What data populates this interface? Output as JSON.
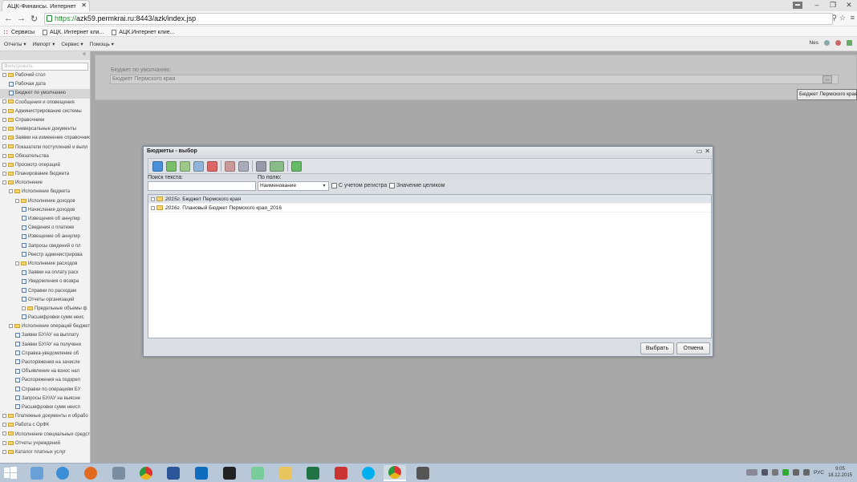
{
  "browser": {
    "tab_title": "АЦК-Финансы. Интернет",
    "url_scheme": "https://",
    "url_rest": "azk59.permkrai.ru:8443/azk/index.jsp",
    "bookmarks": [
      "Сервисы",
      "АЦК. Интернет кли...",
      "АЦК.Интернет клие..."
    ]
  },
  "menubar": {
    "items": [
      "Отчеты ▾",
      "Импорт ▾",
      "Сервис ▾",
      "Помощь ▾"
    ],
    "user": "Nes"
  },
  "sidebar": {
    "filter_placeholder": "Фильтровать",
    "collapse": "«",
    "items": [
      {
        "label": "Рабочий стол",
        "level": 0,
        "type": "folder"
      },
      {
        "label": "Рабочая дата",
        "level": 1,
        "type": "doc"
      },
      {
        "label": "Бюджет по умолчанию",
        "level": 1,
        "type": "doc",
        "selected": true
      },
      {
        "label": "Сообщения и оповещения",
        "level": 0,
        "type": "folder"
      },
      {
        "label": "Администрирование системы",
        "level": 0,
        "type": "folder"
      },
      {
        "label": "Справочники",
        "level": 0,
        "type": "folder"
      },
      {
        "label": "Универсальные документы",
        "level": 0,
        "type": "folder"
      },
      {
        "label": "Заявки на изменение справочник",
        "level": 0,
        "type": "folder"
      },
      {
        "label": "Показатели поступлений и выпл",
        "level": 0,
        "type": "folder"
      },
      {
        "label": "Обязательства",
        "level": 0,
        "type": "folder"
      },
      {
        "label": "Просмотр операций",
        "level": 0,
        "type": "folder"
      },
      {
        "label": "Планирование бюджета",
        "level": 0,
        "type": "folder"
      },
      {
        "label": "Исполнение",
        "level": 0,
        "type": "folder"
      },
      {
        "label": "Исполнение бюджета",
        "level": 1,
        "type": "folder"
      },
      {
        "label": "Исполнение доходов",
        "level": 2,
        "type": "folder"
      },
      {
        "label": "Начисления доходов",
        "level": 3,
        "type": "doc"
      },
      {
        "label": "Извещения об аннулир",
        "level": 3,
        "type": "doc"
      },
      {
        "label": "Сведения о платеже",
        "level": 3,
        "type": "doc"
      },
      {
        "label": "Извещение об аннулир",
        "level": 3,
        "type": "doc"
      },
      {
        "label": "Запросы сведений о пл",
        "level": 3,
        "type": "doc"
      },
      {
        "label": "Реестр администрирова",
        "level": 3,
        "type": "doc"
      },
      {
        "label": "Исполнение расходов",
        "level": 2,
        "type": "folder"
      },
      {
        "label": "Заявки на оплату расх",
        "level": 3,
        "type": "doc"
      },
      {
        "label": "Уведомления о возвра",
        "level": 3,
        "type": "doc"
      },
      {
        "label": "Справки по расходам",
        "level": 3,
        "type": "doc"
      },
      {
        "label": "Отчеты организаций",
        "level": 3,
        "type": "doc"
      },
      {
        "label": "Предельные объемы ф",
        "level": 3,
        "type": "folder"
      },
      {
        "label": "Расшифровки сумм неис",
        "level": 3,
        "type": "doc"
      },
      {
        "label": "Исполнение операций бюджет",
        "level": 1,
        "type": "folder"
      },
      {
        "label": "Заявки БУ/АУ на выплату",
        "level": 2,
        "type": "doc"
      },
      {
        "label": "Заявки БУ/АУ на получени",
        "level": 2,
        "type": "doc"
      },
      {
        "label": "Справка-уведомление об",
        "level": 2,
        "type": "doc"
      },
      {
        "label": "Распоряжения на зачисле",
        "level": 2,
        "type": "doc"
      },
      {
        "label": "Объявление на взнос нал",
        "level": 2,
        "type": "doc"
      },
      {
        "label": "Распоряжения на подкреп",
        "level": 2,
        "type": "doc"
      },
      {
        "label": "Справки по операциям БУ",
        "level": 2,
        "type": "doc"
      },
      {
        "label": "Запросы БУ/АУ на выясне",
        "level": 2,
        "type": "doc"
      },
      {
        "label": "Расшифровки сумм неисп",
        "level": 2,
        "type": "doc"
      },
      {
        "label": "Платежные документы и обрабо",
        "level": 0,
        "type": "folder"
      },
      {
        "label": "Работа с ОрФК",
        "level": 0,
        "type": "folder"
      },
      {
        "label": "Исполнение специальных средст",
        "level": 0,
        "type": "folder"
      },
      {
        "label": "Отчеты учреждений",
        "level": 0,
        "type": "folder"
      },
      {
        "label": "Каталог платных услуг",
        "level": 0,
        "type": "folder"
      }
    ]
  },
  "budget_panel": {
    "label": "Бюджет по умолчанию:",
    "value": "Бюджет Пермского края",
    "button": "...",
    "tooltip": "Бюджет Пермского края"
  },
  "dialog": {
    "title": "Бюджеты - выбор",
    "search_label": "Поиск текста:",
    "field_label": "По полю:",
    "field_value": "Наименование",
    "checkbox_case": "С учетом регистра",
    "checkbox_whole": "Значение целиком",
    "rows": [
      {
        "year": "2015г.",
        "name": "Бюджет Пермского края",
        "selected": true
      },
      {
        "year": "2016г.",
        "name": "Плановый Бюджет Пермского края_2016",
        "selected": false
      }
    ],
    "select_button": "Выбрать",
    "cancel_button": "Отмена"
  },
  "taskbar": {
    "lang": "РУС",
    "time": "9:05",
    "date": "18.12.2015"
  },
  "colors": {
    "dialog_border": "#7f8a96",
    "taskbar": "#b8c8d8",
    "url_secure": "#1d8a2f",
    "folder": "#f3d46b"
  }
}
